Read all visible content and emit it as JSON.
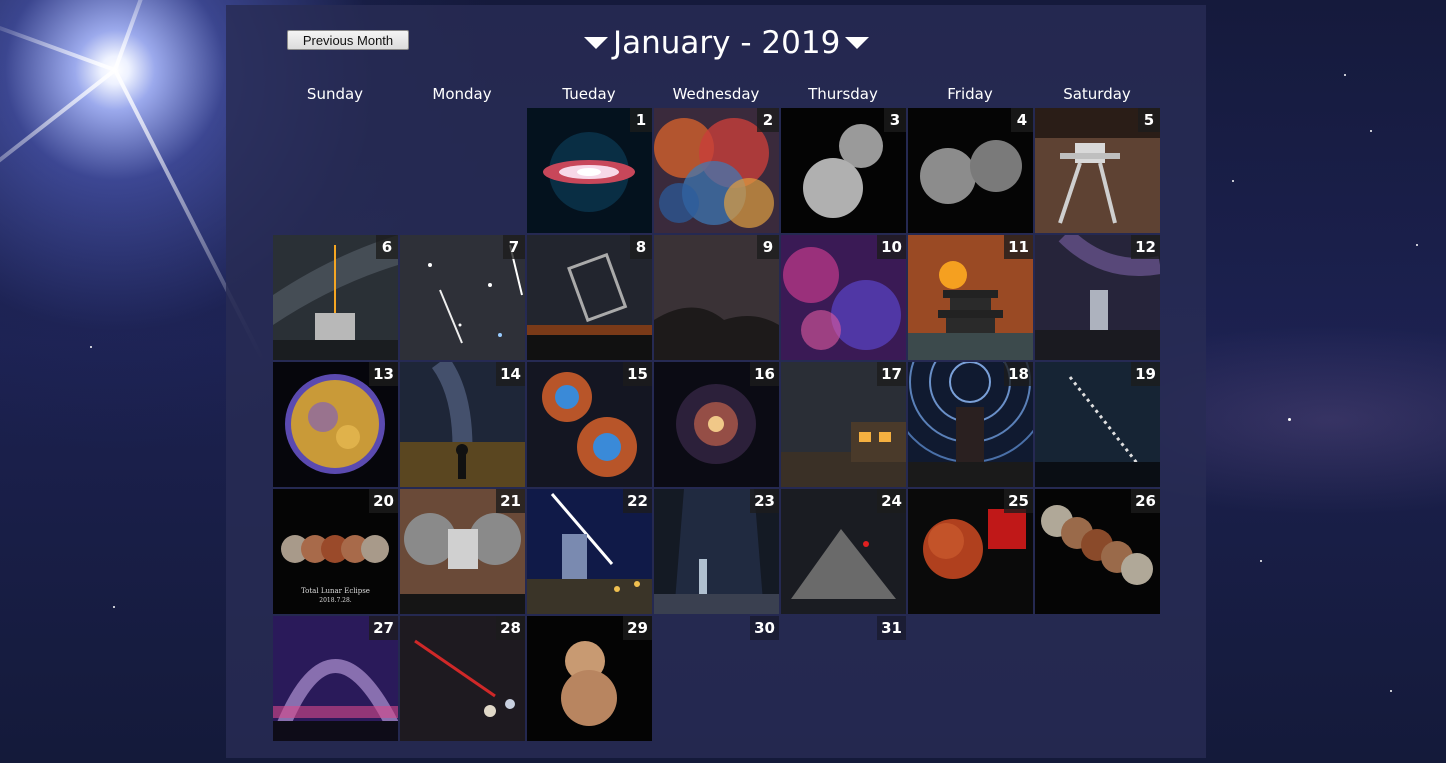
{
  "header": {
    "prev_label": "Previous Month",
    "title": "January - 2019"
  },
  "days_of_week": [
    "Sunday",
    "Monday",
    "Tueday",
    "Wednesday",
    "Thursday",
    "Friday",
    "Saturday"
  ],
  "days": [
    {
      "day": "1",
      "image": "sombrero-galaxy"
    },
    {
      "day": "2",
      "image": "colorful-nebula"
    },
    {
      "day": "3",
      "image": "ultima-thule"
    },
    {
      "day": "4",
      "image": "ultima-thule-closeup"
    },
    {
      "day": "5",
      "image": "lunar-lander"
    },
    {
      "day": "6",
      "image": "observatory-laser"
    },
    {
      "day": "7",
      "image": "meteor-streak"
    },
    {
      "day": "8",
      "image": "radio-telescope"
    },
    {
      "day": "9",
      "image": "dark-hills"
    },
    {
      "day": "10",
      "image": "vela-remnant"
    },
    {
      "day": "11",
      "image": "eclipse-pagoda"
    },
    {
      "day": "12",
      "image": "milky-way-waterfall"
    },
    {
      "day": "13",
      "image": "supernova-remnant"
    },
    {
      "day": "14",
      "image": "meteor-over-city"
    },
    {
      "day": "15",
      "image": "heart-nebula"
    },
    {
      "day": "16",
      "image": "spiral-galaxy"
    },
    {
      "day": "17",
      "image": "cabin-night"
    },
    {
      "day": "18",
      "image": "star-trails"
    },
    {
      "day": "19",
      "image": "eclipse-sequence"
    },
    {
      "day": "20",
      "image": "total-lunar-eclipse"
    },
    {
      "day": "21",
      "image": "spacecraft-selfie"
    },
    {
      "day": "22",
      "image": "cathedral-meteor"
    },
    {
      "day": "23",
      "image": "cave-waterfall"
    },
    {
      "day": "24",
      "image": "mountain-peak"
    },
    {
      "day": "25",
      "image": "red-moon"
    },
    {
      "day": "26",
      "image": "moon-sequence"
    },
    {
      "day": "27",
      "image": "milky-way-arch"
    },
    {
      "day": "28",
      "image": "comet-galaxies"
    },
    {
      "day": "29",
      "image": "ultima-thule-color"
    },
    {
      "day": "30",
      "image": ""
    },
    {
      "day": "31",
      "image": ""
    }
  ],
  "thumb_text": {
    "d20": "Total Lunar Eclipse",
    "d20_date": "2018.7.28."
  },
  "colors": {
    "panel": "#282c54",
    "number_badge": "#1c1c1c"
  }
}
